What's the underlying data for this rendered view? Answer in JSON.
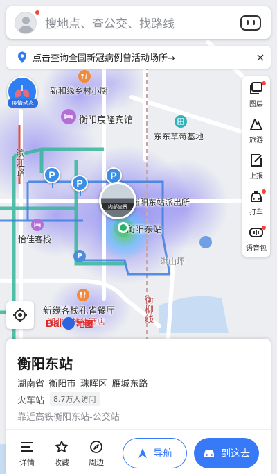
{
  "search": {
    "placeholder": "搜地点、查公交、找路线"
  },
  "notice": {
    "text": "点击查询全国新冠病例曾活动场所→",
    "close": "×"
  },
  "epidemic_badge": {
    "label": "疫情动态"
  },
  "toolbar": {
    "items": [
      {
        "label": "图层",
        "icon": "layers-icon",
        "dot": true
      },
      {
        "label": "旅游",
        "icon": "travel-icon",
        "dot": false
      },
      {
        "label": "上报",
        "icon": "report-icon",
        "dot": false
      },
      {
        "label": "打车",
        "icon": "taxi-icon",
        "dot": true
      },
      {
        "label": "语音包",
        "icon": "voice-pack-icon",
        "dot": true
      }
    ]
  },
  "map": {
    "labels": {
      "restaurant": "新和缘乡村小厨",
      "hotel1": "衡阳宸隆宾馆",
      "strawberry": "东东草莓基地",
      "police": "衡阳东站派出所",
      "hotel2": "怡佳客栈",
      "station": "衡阳东站",
      "hongshanping": "洪山坪",
      "hotel3": "新缘客栈孔雀餐厅",
      "hotel4": "湘北客栈待酒店",
      "road1": "滨江路",
      "road2": "衡柳线"
    },
    "station_thumb_label": "内部全景",
    "parking_symbol": "P",
    "logo": {
      "text1": "Bai",
      "text2": "地图"
    }
  },
  "card": {
    "title": "衡阳东站",
    "address": "湖南省–衡阳市–珠晖区–雁城东路",
    "category": "火车站",
    "visits": "8.7万人访问",
    "nearby": "靠近高铁衡阳东站-公交站",
    "actions": [
      {
        "label": "详情",
        "icon": "list-icon"
      },
      {
        "label": "收藏",
        "icon": "star-icon"
      },
      {
        "label": "周边",
        "icon": "compass-icon"
      }
    ],
    "navigate": "导航",
    "go_here": "到这去"
  },
  "colors": {
    "accent": "#3779f6",
    "heat": "#6f6cf0",
    "road_green": "#2fb89a"
  }
}
